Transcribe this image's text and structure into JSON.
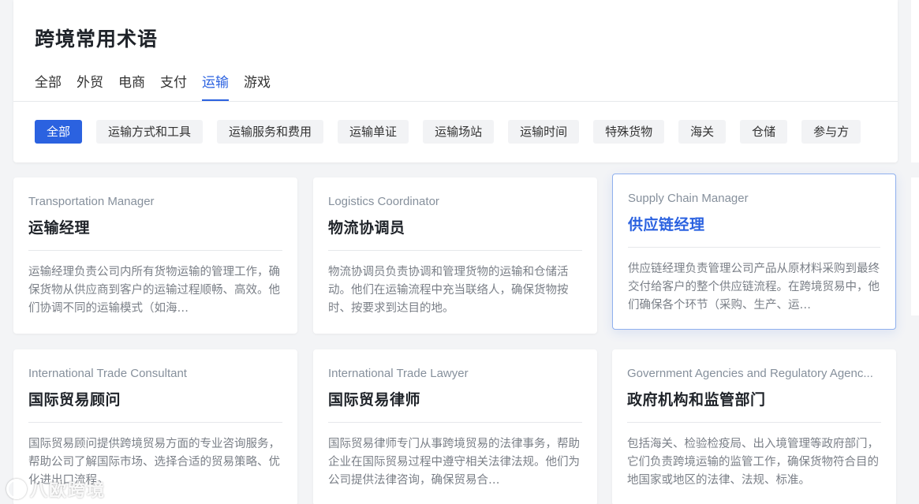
{
  "page": {
    "title": "跨境常用术语"
  },
  "tabs": [
    {
      "label": "全部",
      "active": false
    },
    {
      "label": "外贸",
      "active": false
    },
    {
      "label": "电商",
      "active": false
    },
    {
      "label": "支付",
      "active": false
    },
    {
      "label": "运输",
      "active": true
    },
    {
      "label": "游戏",
      "active": false
    }
  ],
  "filters": [
    {
      "label": "全部",
      "active": true
    },
    {
      "label": "运输方式和工具",
      "active": false
    },
    {
      "label": "运输服务和费用",
      "active": false
    },
    {
      "label": "运输单证",
      "active": false
    },
    {
      "label": "运输场站",
      "active": false
    },
    {
      "label": "运输时间",
      "active": false
    },
    {
      "label": "特殊货物",
      "active": false
    },
    {
      "label": "海关",
      "active": false
    },
    {
      "label": "仓储",
      "active": false
    },
    {
      "label": "参与方",
      "active": false
    }
  ],
  "cards": [
    {
      "en": "Transportation Manager",
      "zh": "运输经理",
      "desc": "运输经理负责公司内所有货物运输的管理工作，确保货物从供应商到客户的运输过程顺畅、高效。他们协调不同的运输模式（如海…"
    },
    {
      "en": "Logistics Coordinator",
      "zh": "物流协调员",
      "desc": "物流协调员负责协调和管理货物的运输和仓储活动。他们在运输流程中充当联络人，确保货物按时、按要求到达目的地。"
    },
    {
      "en": "Supply Chain Manager",
      "zh": "供应链经理",
      "desc": "供应链经理负责管理公司产品从原材料采购到最终交付给客户的整个供应链流程。在跨境贸易中，他们确保各个环节（采购、生产、运…",
      "highlight": true
    },
    {
      "en": "International Trade Consultant",
      "zh": "国际贸易顾问",
      "desc": "国际贸易顾问提供跨境贸易方面的专业咨询服务，帮助公司了解国际市场、选择合适的贸易策略、优化进出口流程。"
    },
    {
      "en": "International Trade Lawyer",
      "zh": "国际贸易律师",
      "desc": "国际贸易律师专门从事跨境贸易的法律事务，帮助企业在国际贸易过程中遵守相关法律法规。他们为公司提供法律咨询，确保贸易合…"
    },
    {
      "en": "Government Agencies and Regulatory Agenc...",
      "zh": "政府机构和监管部门",
      "desc": "包括海关、检验检疫局、出入境管理等政府部门，它们负责跨境运输的监管工作，确保货物符合目的地国家或地区的法律、法规、标准。"
    }
  ],
  "watermark": {
    "text": "八欧跨境"
  }
}
